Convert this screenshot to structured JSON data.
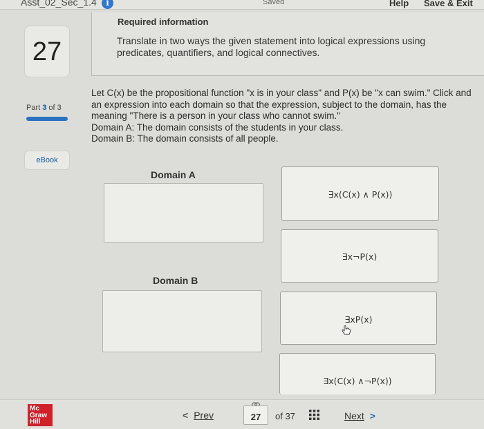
{
  "header": {
    "title": "Asst_02_Sec_1.4",
    "info_icon": "i",
    "status": "Saved",
    "help": "Help",
    "save_exit": "Save & Exit"
  },
  "sidebar": {
    "question_number": "27",
    "part_prefix": "Part ",
    "part_current": "3",
    "part_suffix": " of 3",
    "ebook": "eBook"
  },
  "required": {
    "title": "Required information",
    "text": "Translate in two ways the given statement into logical expressions using predicates, quantifiers, and logical connectives."
  },
  "question": {
    "lines": [
      "Let C(x) be the propositional function \"x is in your class\" and P(x) be \"x can swim.\" Click and",
      "an expression into each domain so that the expression, subject to the domain, has the",
      "meaning \"There is a person in your class who cannot swim.\"",
      "Domain A: The domain consists of the students in your class.",
      "Domain B: The domain consists of all people."
    ]
  },
  "domains": {
    "a_label": "Domain A",
    "b_label": "Domain B"
  },
  "options": [
    "∃x(C(x) ∧ P(x))",
    "∃x¬P(x)",
    "∃xP(x)",
    "∃x(C(x) ∧¬P(x))"
  ],
  "footer": {
    "logo": [
      "Mc",
      "Graw",
      "Hill"
    ],
    "prev_chevron": "<",
    "prev": "Prev",
    "page": "27",
    "of_total": "of 37",
    "next": "Next",
    "next_chevron": ">"
  },
  "colors": {
    "accent": "#2b72c0",
    "brand_red": "#d0202a"
  }
}
